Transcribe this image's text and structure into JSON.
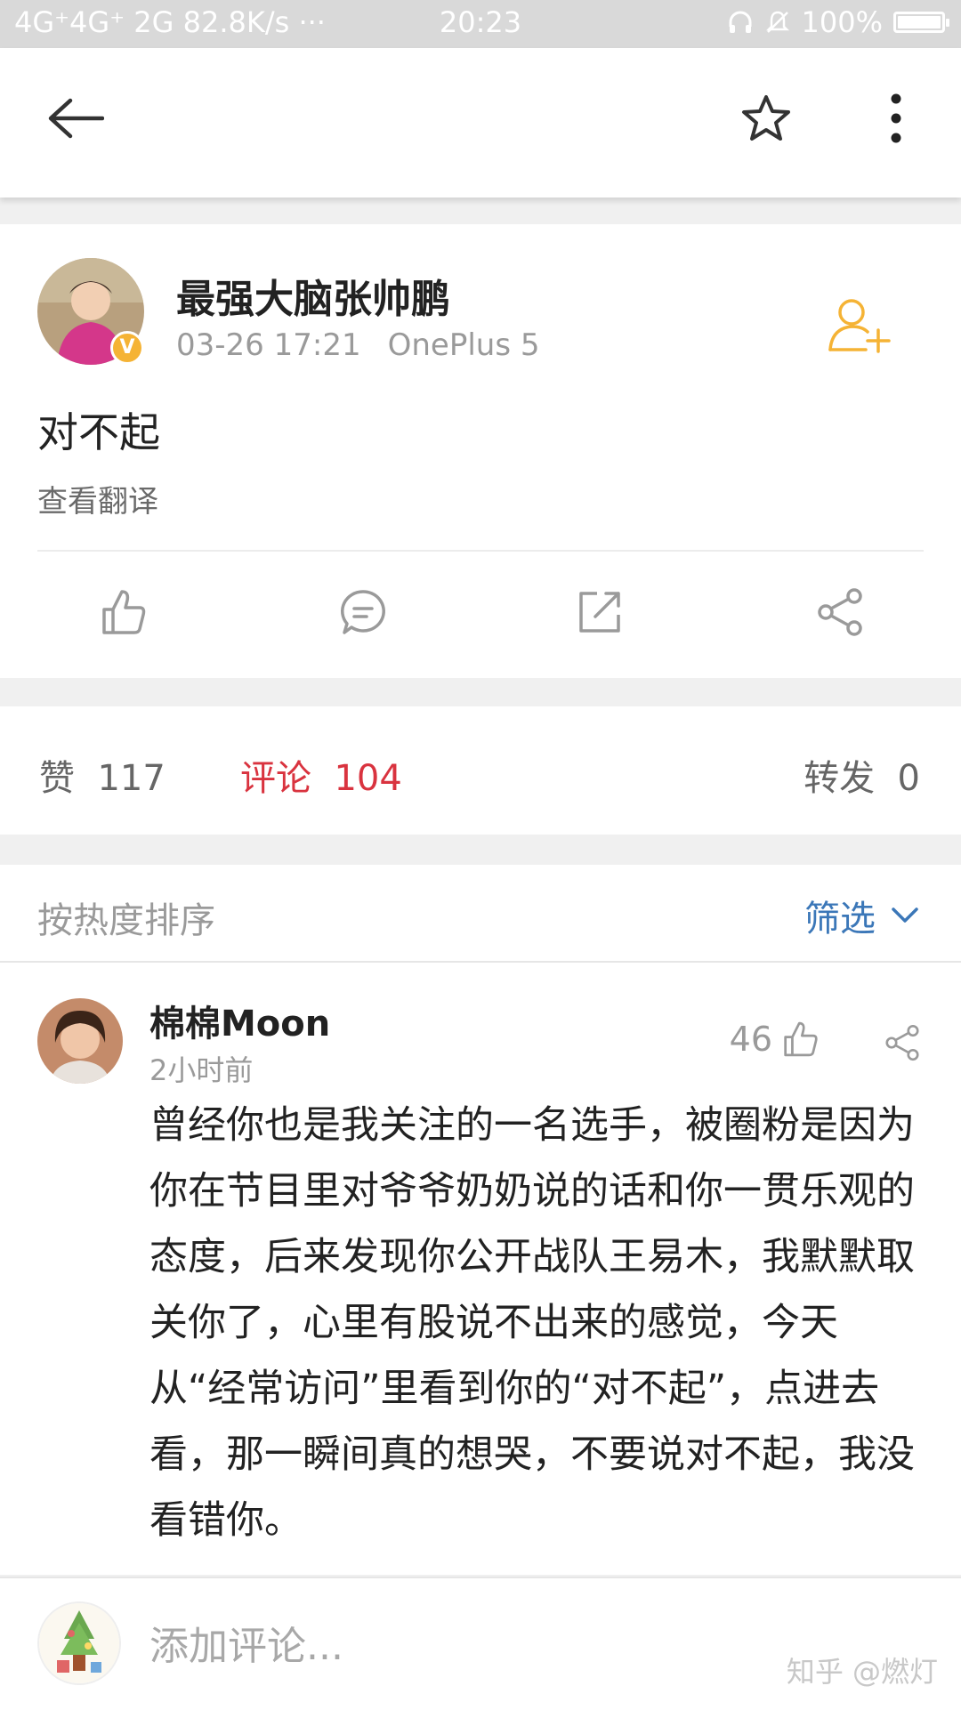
{
  "status_bar": {
    "left": "4G⁺4G⁺ 2G 82.8K/s ···",
    "time": "20:23",
    "battery": "100%"
  },
  "nav": {
    "icons": [
      "back-arrow-icon",
      "star-icon",
      "more-vertical-icon"
    ]
  },
  "post": {
    "author": "最强大脑张帅鹏",
    "date": "03-26 17:21",
    "device": "OnePlus 5",
    "text": "对不起",
    "translate": "查看翻译",
    "verified_badge": "V",
    "actions": [
      "like-icon",
      "comment-icon",
      "repost-icon",
      "share-icon"
    ]
  },
  "stats": {
    "likes_label": "赞",
    "likes": "117",
    "comments_label": "评论",
    "comments": "104",
    "reposts_label": "转发",
    "reposts": "0"
  },
  "sort": {
    "label": "按热度排序",
    "filter": "筛选"
  },
  "comment": {
    "name": "棉棉Moon",
    "time": "2小时前",
    "likes": "46",
    "text": "曾经你也是我关注的一名选手，被圈粉是因为你在节目里对爷爷奶奶说的话和你一贯乐观的态度，后来发现你公开战队王易木，我默默取关你了，心里有股说不出来的感觉，今天从“经常访问”里看到你的“对不起”，点进去看，那一瞬间真的想哭，不要说对不起，我没看错你。"
  },
  "bottom": {
    "placeholder": "添加评论...",
    "watermark": "知乎 @燃灯"
  },
  "colors": {
    "accent_red": "#d9333f",
    "link_blue": "#3b77b8",
    "follow_orange": "#f5b335"
  }
}
